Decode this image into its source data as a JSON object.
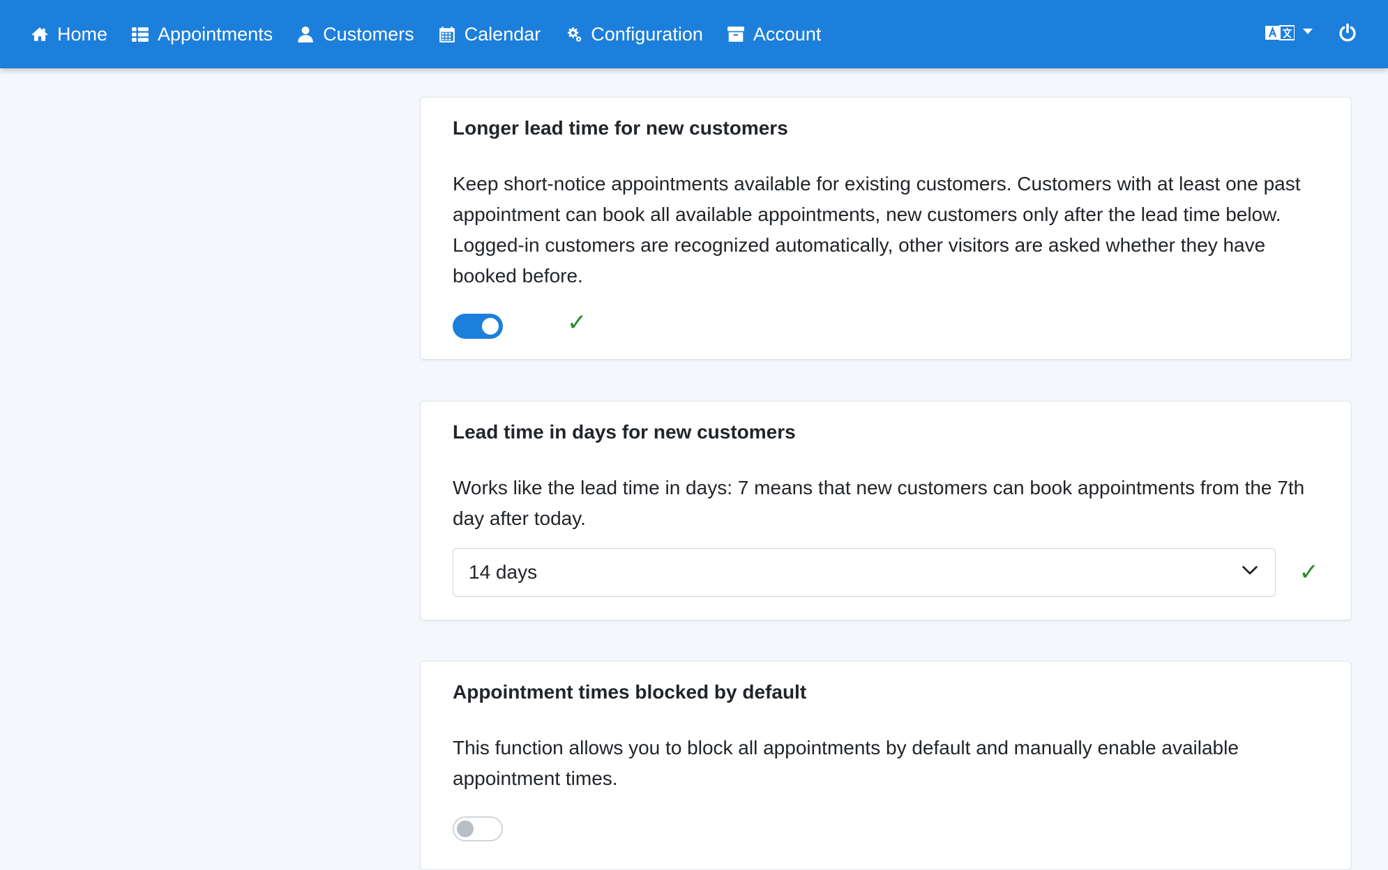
{
  "nav": {
    "items": [
      {
        "label": "Home",
        "icon": "home-icon"
      },
      {
        "label": "Appointments",
        "icon": "list-icon"
      },
      {
        "label": "Customers",
        "icon": "user-icon"
      },
      {
        "label": "Calendar",
        "icon": "calendar-icon"
      },
      {
        "label": "Configuration",
        "icon": "gears-icon"
      },
      {
        "label": "Account",
        "icon": "archive-icon"
      }
    ],
    "language_icon": "translate-icon",
    "power_icon": "power-icon"
  },
  "colors": {
    "primary": "#1c7fdc",
    "success": "#2b8a2b",
    "background": "#f4f8fc"
  },
  "cards": [
    {
      "title": "Longer lead time for new customers",
      "description": "Keep short-notice appointments available for existing customers. Customers with at least one past appointment can book all available appointments, new customers only after the lead time below. Logged-in customers are recognized automatically, other visitors are asked whether they have booked before.",
      "toggle_state": "on",
      "saved_mark": "✓"
    },
    {
      "title": "Lead time in days for new customers",
      "description": "Works like the lead time in days: 7 means that new customers can book appointments from the 7th day after today.",
      "select_value": "14 days",
      "saved_mark": "✓"
    },
    {
      "title": "Appointment times blocked by default",
      "description": "This function allows you to block all appointments by default and manually enable available appointment times.",
      "toggle_state": "off"
    }
  ]
}
